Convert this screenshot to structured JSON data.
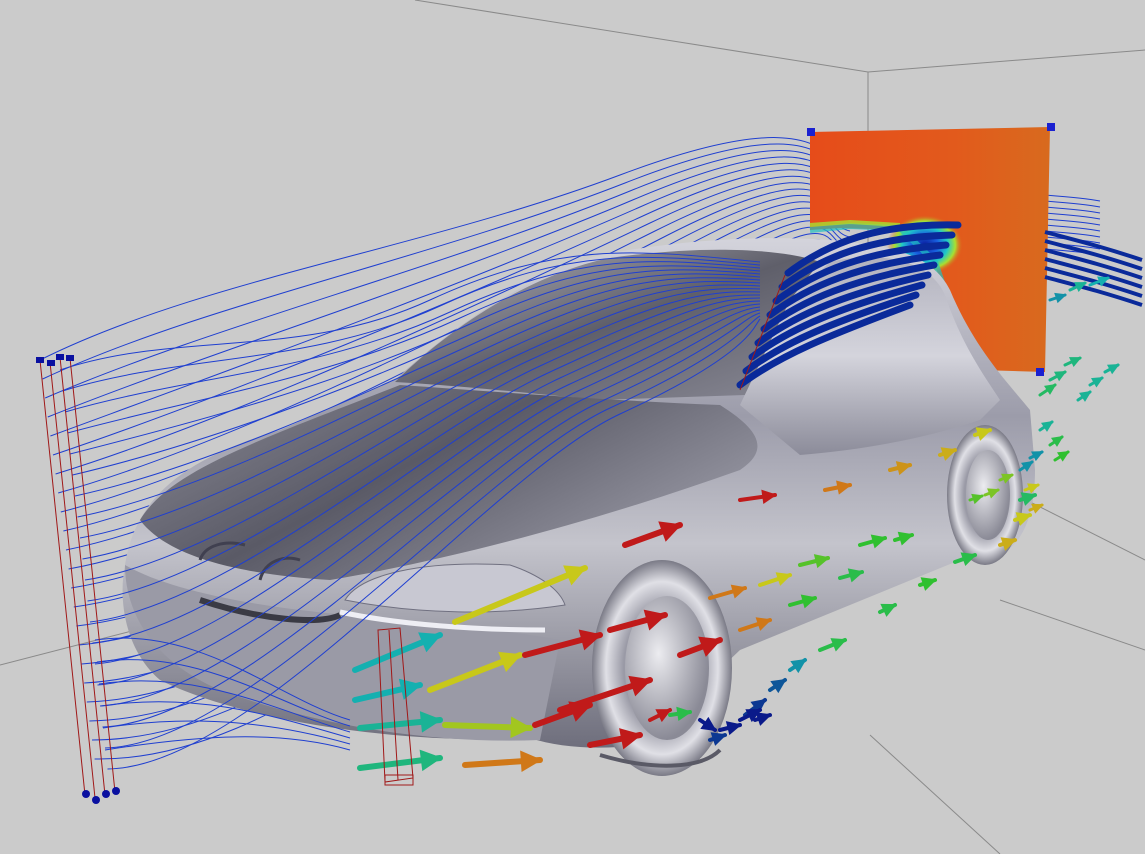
{
  "scene": {
    "colors": {
      "background": "#cbcbcb",
      "room_edges": "#8a8a8a",
      "car_body": "#a7a7b2",
      "streamline": "#1f3fd0",
      "ribbon": "#0a2a9a",
      "rake": "#a01818",
      "rake_handle": "#0a10a0",
      "cut_plane_hot": "#e2521c",
      "cut_plane_cold": "#1030c0"
    },
    "velocity_scale": [
      {
        "level": 0.0,
        "color": "#0a1a8a"
      },
      {
        "level": 0.25,
        "color": "#14b0b0"
      },
      {
        "level": 0.5,
        "color": "#30c030"
      },
      {
        "level": 0.7,
        "color": "#c8c81a"
      },
      {
        "level": 0.85,
        "color": "#d07818"
      },
      {
        "level": 1.0,
        "color": "#c01a1a"
      }
    ]
  }
}
